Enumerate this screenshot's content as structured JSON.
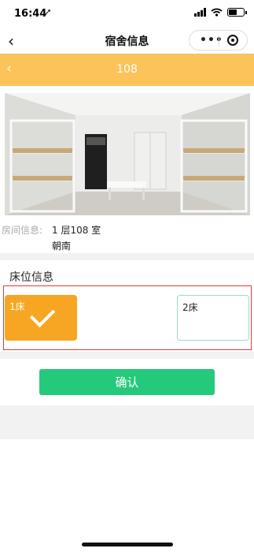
{
  "status_bar": {
    "time": "16:44",
    "location_glyph": "➚"
  },
  "nav": {
    "back_glyph": "‹",
    "title": "宿舍信息",
    "more_glyph": "•••"
  },
  "header": {
    "back_glyph": "‹",
    "room_number": "108"
  },
  "room_info": {
    "label": "房间信息:",
    "line1": "1 层108 室",
    "line2": "朝南"
  },
  "beds": {
    "section_title": "床位信息",
    "items": [
      {
        "label": "1床",
        "selected": true
      },
      {
        "label": "2床",
        "selected": false
      }
    ]
  },
  "confirm_label": "确认",
  "colors": {
    "header_bg": "#fcc35a",
    "bed_selected": "#f7a623",
    "bed_unselected_border": "#9fd8d0",
    "confirm_bg": "#25c97b",
    "highlight_border": "#e53935"
  },
  "icons": [
    "location-icon",
    "signal-icon",
    "wifi-icon",
    "battery-icon",
    "back-icon",
    "more-icon",
    "target-icon",
    "check-icon"
  ]
}
